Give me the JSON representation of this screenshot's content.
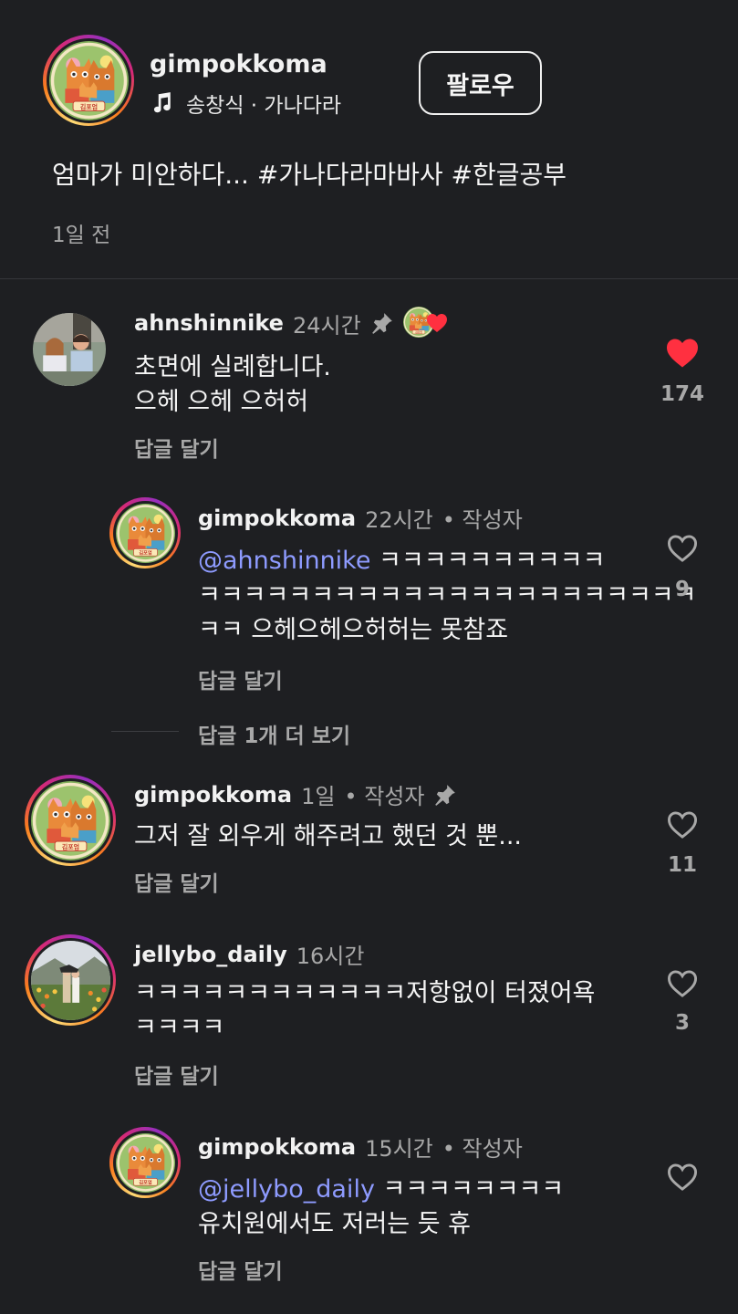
{
  "post": {
    "username": "gimpokkoma",
    "music_label": "송창식 · 가나다라",
    "follow_label": "팔로우",
    "caption": "엄마가 미안하다... #가나다라마바사 #한글공부",
    "time": "1일 전"
  },
  "comments": [
    {
      "username": "ahnshinnike",
      "time": "24시간",
      "text_line1": "초면에 실례합니다.",
      "text_line2": "으헤 으헤 으허허",
      "reply_label": "답글 달기",
      "like_count": "174",
      "liked": true,
      "pinned": true,
      "creator_liked": true
    },
    {
      "username": "gimpokkoma",
      "time": "22시간",
      "author_tag": "• 작성자",
      "mention": "@ahnshinnike",
      "text_line1": " ㅋㅋㅋㅋㅋㅋㅋㅋㅋㅋ",
      "text_line2": "ㅋㅋㅋㅋㅋㅋㅋㅋㅋㅋㅋㅋㅋㅋㅋㅋㅋㅋㅋㅋㅋㅋ",
      "text_line3": "ㅋㅋ 으헤으헤으허허는 못참죠",
      "reply_label": "답글 달기",
      "like_count": "9",
      "more_replies": "답글 1개 더 보기"
    },
    {
      "username": "gimpokkoma",
      "time": "1일",
      "author_tag": "• 작성자",
      "text_line1": "그저 잘 외우게 해주려고 했던 것 뿐...",
      "reply_label": "답글 달기",
      "like_count": "11",
      "pinned": true
    },
    {
      "username": "jellybo_daily",
      "time": "16시간",
      "text_line1": "ㅋㅋㅋㅋㅋㅋㅋㅋㅋㅋㅋㅋ저항없이 터졌어욕",
      "text_line2": "ㅋㅋㅋㅋ",
      "reply_label": "답글 달기",
      "like_count": "3"
    },
    {
      "username": "gimpokkoma",
      "time": "15시간",
      "author_tag": "• 작성자",
      "mention": "@jellybo_daily",
      "text_line1": " ㅋㅋㅋㅋㅋㅋㅋㅋ",
      "text_line2": "유치원에서도 저러는 듯 휴",
      "reply_label": "답글 달기"
    }
  ],
  "colors": {
    "background": "#1e1f22",
    "mention": "#8e9bff",
    "like_red": "#ff3040",
    "muted": "#a8a8a8"
  },
  "icons": [
    "music-note-icon",
    "pin-icon",
    "heart-icon",
    "heart-outline-icon",
    "avatar"
  ]
}
